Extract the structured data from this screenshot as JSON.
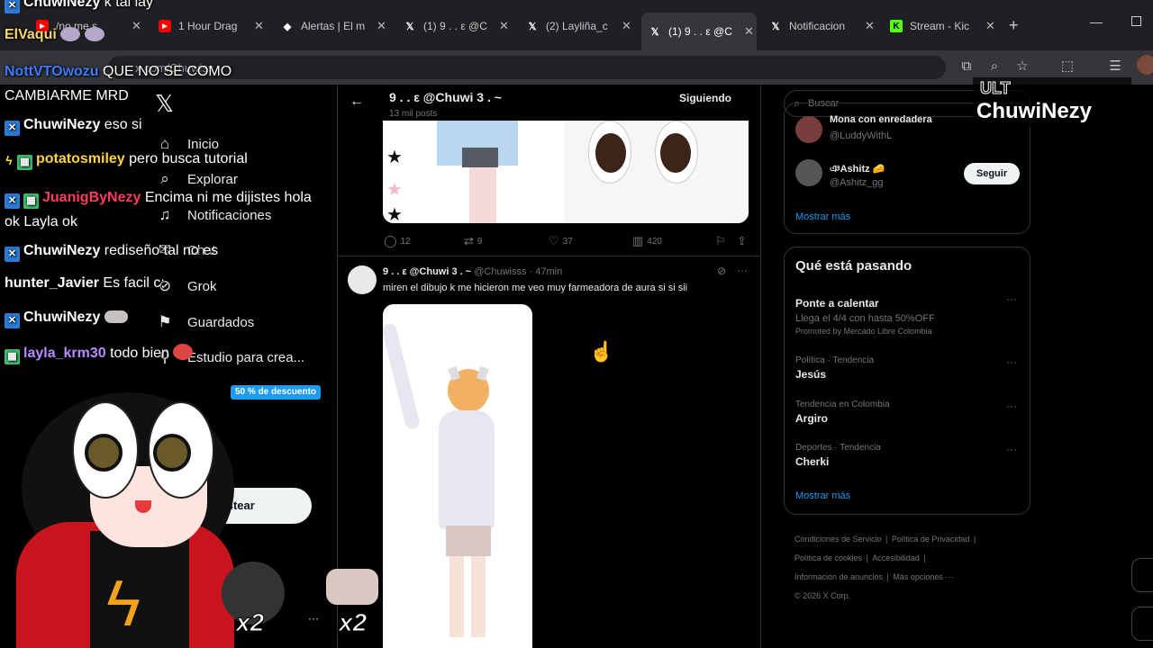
{
  "browser": {
    "tabs": [
      {
        "title": "/no me s",
        "icon": "youtube-icon",
        "color": "#ff0000"
      },
      {
        "title": "1 Hour Drag",
        "icon": "youtube-icon",
        "color": "#ff0000"
      },
      {
        "title": "Alertas | El m",
        "icon": "streamelements-icon",
        "color": "#ffffff"
      },
      {
        "title": "(1) 9 . . ε @C",
        "icon": "x-logo-icon",
        "color": "#ffffff"
      },
      {
        "title": "(2) Layliña_c",
        "icon": "x-logo-icon",
        "color": "#ffffff"
      },
      {
        "title": "(1) 9 . . ε @C",
        "icon": "x-logo-icon",
        "color": "#ffffff",
        "active": true
      },
      {
        "title": "Notificacion",
        "icon": "x-logo-icon",
        "color": "#ffffff"
      },
      {
        "title": "Stream - Kic",
        "icon": "kick-icon",
        "color": "#53fc18"
      }
    ],
    "url": "x.com/Chuwiss"
  },
  "nav": {
    "items": [
      "Inicio",
      "Explorar",
      "Notificaciones",
      "Chat",
      "Grok",
      "Guardados",
      "Estudio para crea...",
      "aciones"
    ],
    "promo_badge": "50 % de descuento",
    "post_button": "Postear"
  },
  "profile": {
    "name": "9 . . ε @Chuwi 3 . ~",
    "posts_count": "13 mil posts",
    "follow_button": "Siguiendo"
  },
  "tweet1": {
    "stats": {
      "replies": "12",
      "retweets": "9",
      "likes": "37",
      "views": "420"
    }
  },
  "tweet2": {
    "author": "9 . . ε @Chuwi 3 . ~",
    "handle": "@Chuwisss",
    "time": "47min",
    "text": "miren el dibujo k me hicieron me veo muy farmeadora de aura si si sii"
  },
  "sidebar": {
    "search_placeholder": "Buscar",
    "who_to_follow": [
      {
        "name": "Mona con enredadera",
        "handle": "@LuddyWithL"
      },
      {
        "name": "ঞAshitz 🧀",
        "handle": "@Ashitz_gg",
        "button": "Seguir"
      }
    ],
    "show_more": "Mostrar más",
    "trends_title": "Qué está pasando",
    "trends": [
      {
        "meta": "",
        "name": "Ponte a calentar",
        "desc": "Llega el 4/4 con hasta 50%OFF",
        "promo": "Promoted by Mercado Libre Colombia"
      },
      {
        "meta": "Política · Tendencia",
        "name": "Jesús"
      },
      {
        "meta": "Tendencia en Colombia",
        "name": "Argiro"
      },
      {
        "meta": "Deportes · Tendencia",
        "name": "Cherki"
      }
    ],
    "show_more_2": "Mostrar más",
    "footer": [
      "Condiciones de Servicio",
      "Política de Privacidad",
      "Política de cookies",
      "Accesibilidad",
      "Información de anuncios",
      "Más opciones ···",
      "© 2026 X Corp."
    ]
  },
  "overlay": {
    "streamer_logo": "ChuwiNezy",
    "logo_top": "ULT",
    "multiplier": "x2",
    "chat": [
      {
        "user": "ChuwiNezy",
        "msg": "k tal lay",
        "color": "#ffffff",
        "badge": "x"
      },
      {
        "user": "ElVaqui",
        "msg": "",
        "color": "#f5d76e",
        "badge": ""
      },
      {
        "user": "NottVTOwozu",
        "msg": "QUE NO SE COMO CAMBIARME MRD",
        "color": "#3d7bff",
        "badge": ""
      },
      {
        "user": "ChuwiNezy",
        "msg": "eso si",
        "color": "#ffffff",
        "badge": "x"
      },
      {
        "user": "potatosmiley",
        "msg": "pero busca tutorial",
        "color": "#ffd33d",
        "badge": "sub"
      },
      {
        "user": "JuanigByNezy",
        "msg": "Encima ni me dijistes hola ok Layla ok",
        "color": "#ff3d5f",
        "badge": "x"
      },
      {
        "user": "ChuwiNezy",
        "msg": "rediseño tal no es",
        "color": "#ffffff",
        "badge": "x"
      },
      {
        "user": "hunter_Javier",
        "msg": "Es facil c:",
        "color": "#ffffff",
        "badge": ""
      },
      {
        "user": "ChuwiNezy",
        "msg": "",
        "color": "#ffffff",
        "badge": "x"
      },
      {
        "user": "layla_krm30",
        "msg": "todo bien",
        "color": "#b58cff",
        "badge": "g"
      }
    ]
  }
}
